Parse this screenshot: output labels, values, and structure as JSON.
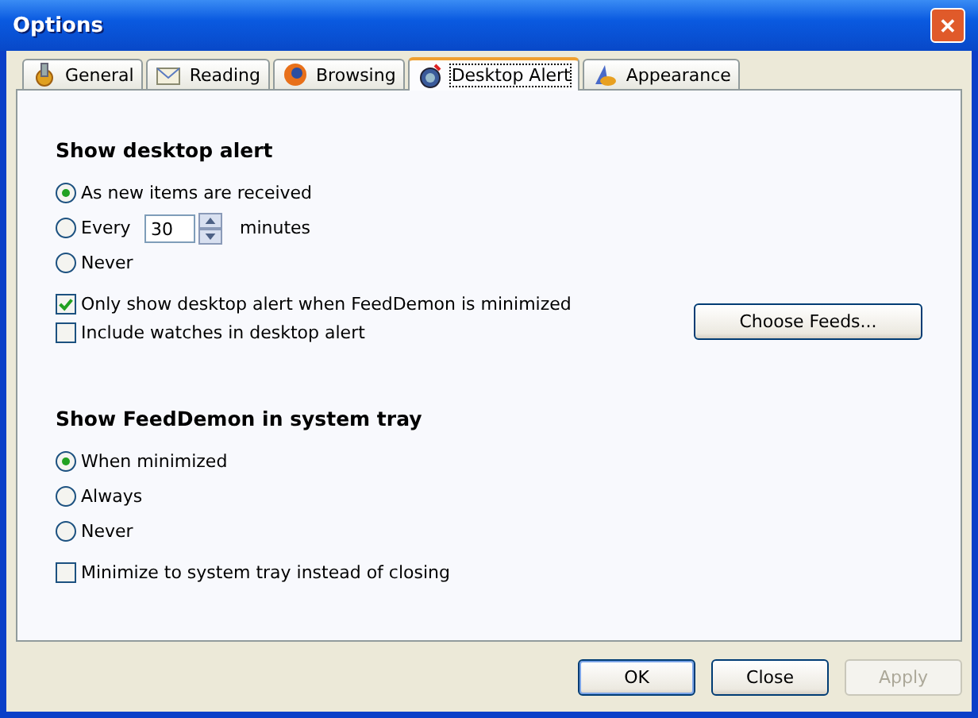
{
  "window": {
    "title": "Options",
    "close": "✕"
  },
  "tabs": [
    {
      "label": "General",
      "selected": false
    },
    {
      "label": "Reading",
      "selected": false
    },
    {
      "label": "Browsing",
      "selected": false
    },
    {
      "label": "Desktop Alert",
      "selected": true
    },
    {
      "label": "Appearance",
      "selected": false
    }
  ],
  "sections": [
    {
      "heading": "Show desktop alert",
      "options": [
        {
          "kind": "plain",
          "label": "As new items are received",
          "selected": true
        },
        {
          "kind": "interval",
          "label": "Every",
          "value": "30",
          "unit": "minutes",
          "selected": false
        },
        {
          "kind": "plain",
          "label": "Never",
          "selected": false
        }
      ],
      "checkboxes": [
        {
          "label": "Only show desktop alert when FeedDemon is minimized",
          "checked": true
        },
        {
          "label": "Include watches in desktop alert",
          "checked": false
        }
      ],
      "button": "Choose Feeds..."
    },
    {
      "heading": "Show FeedDemon in system tray",
      "options": [
        {
          "kind": "plain",
          "label": "When minimized",
          "selected": true
        },
        {
          "kind": "plain",
          "label": "Always",
          "selected": false
        },
        {
          "kind": "plain",
          "label": "Never",
          "selected": false
        }
      ],
      "checkboxes": [
        {
          "label": "Minimize to system tray instead of closing",
          "checked": false
        }
      ]
    }
  ],
  "buttons": [
    {
      "label": "OK",
      "disabled": false,
      "default": true
    },
    {
      "label": "Close",
      "disabled": false,
      "default": false
    },
    {
      "label": "Apply",
      "disabled": true,
      "default": false
    }
  ]
}
